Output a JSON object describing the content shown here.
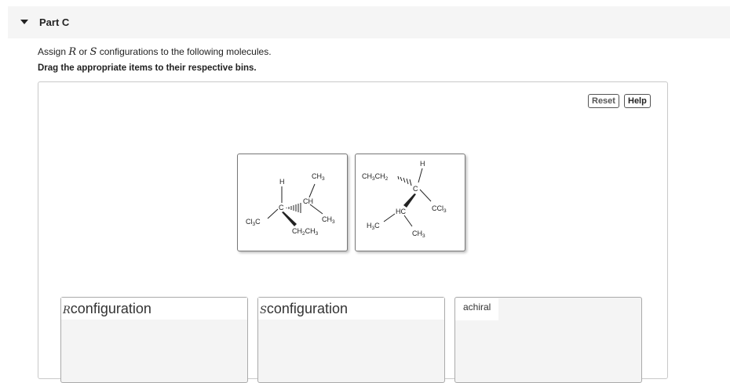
{
  "part": {
    "title": "Part C"
  },
  "instructions": {
    "line1_prefix": "Assign ",
    "var_r": "R",
    "line1_or": " or ",
    "var_s": "S",
    "line1_suffix": " configurations to the following molecules.",
    "line2": "Drag the appropriate items to their respective bins."
  },
  "buttons": {
    "reset": "Reset",
    "help": "Help"
  },
  "bins": [
    {
      "var": "R",
      "label": "configuration"
    },
    {
      "var": "S",
      "label": "configuration"
    },
    {
      "var": "",
      "label": "achiral"
    }
  ]
}
